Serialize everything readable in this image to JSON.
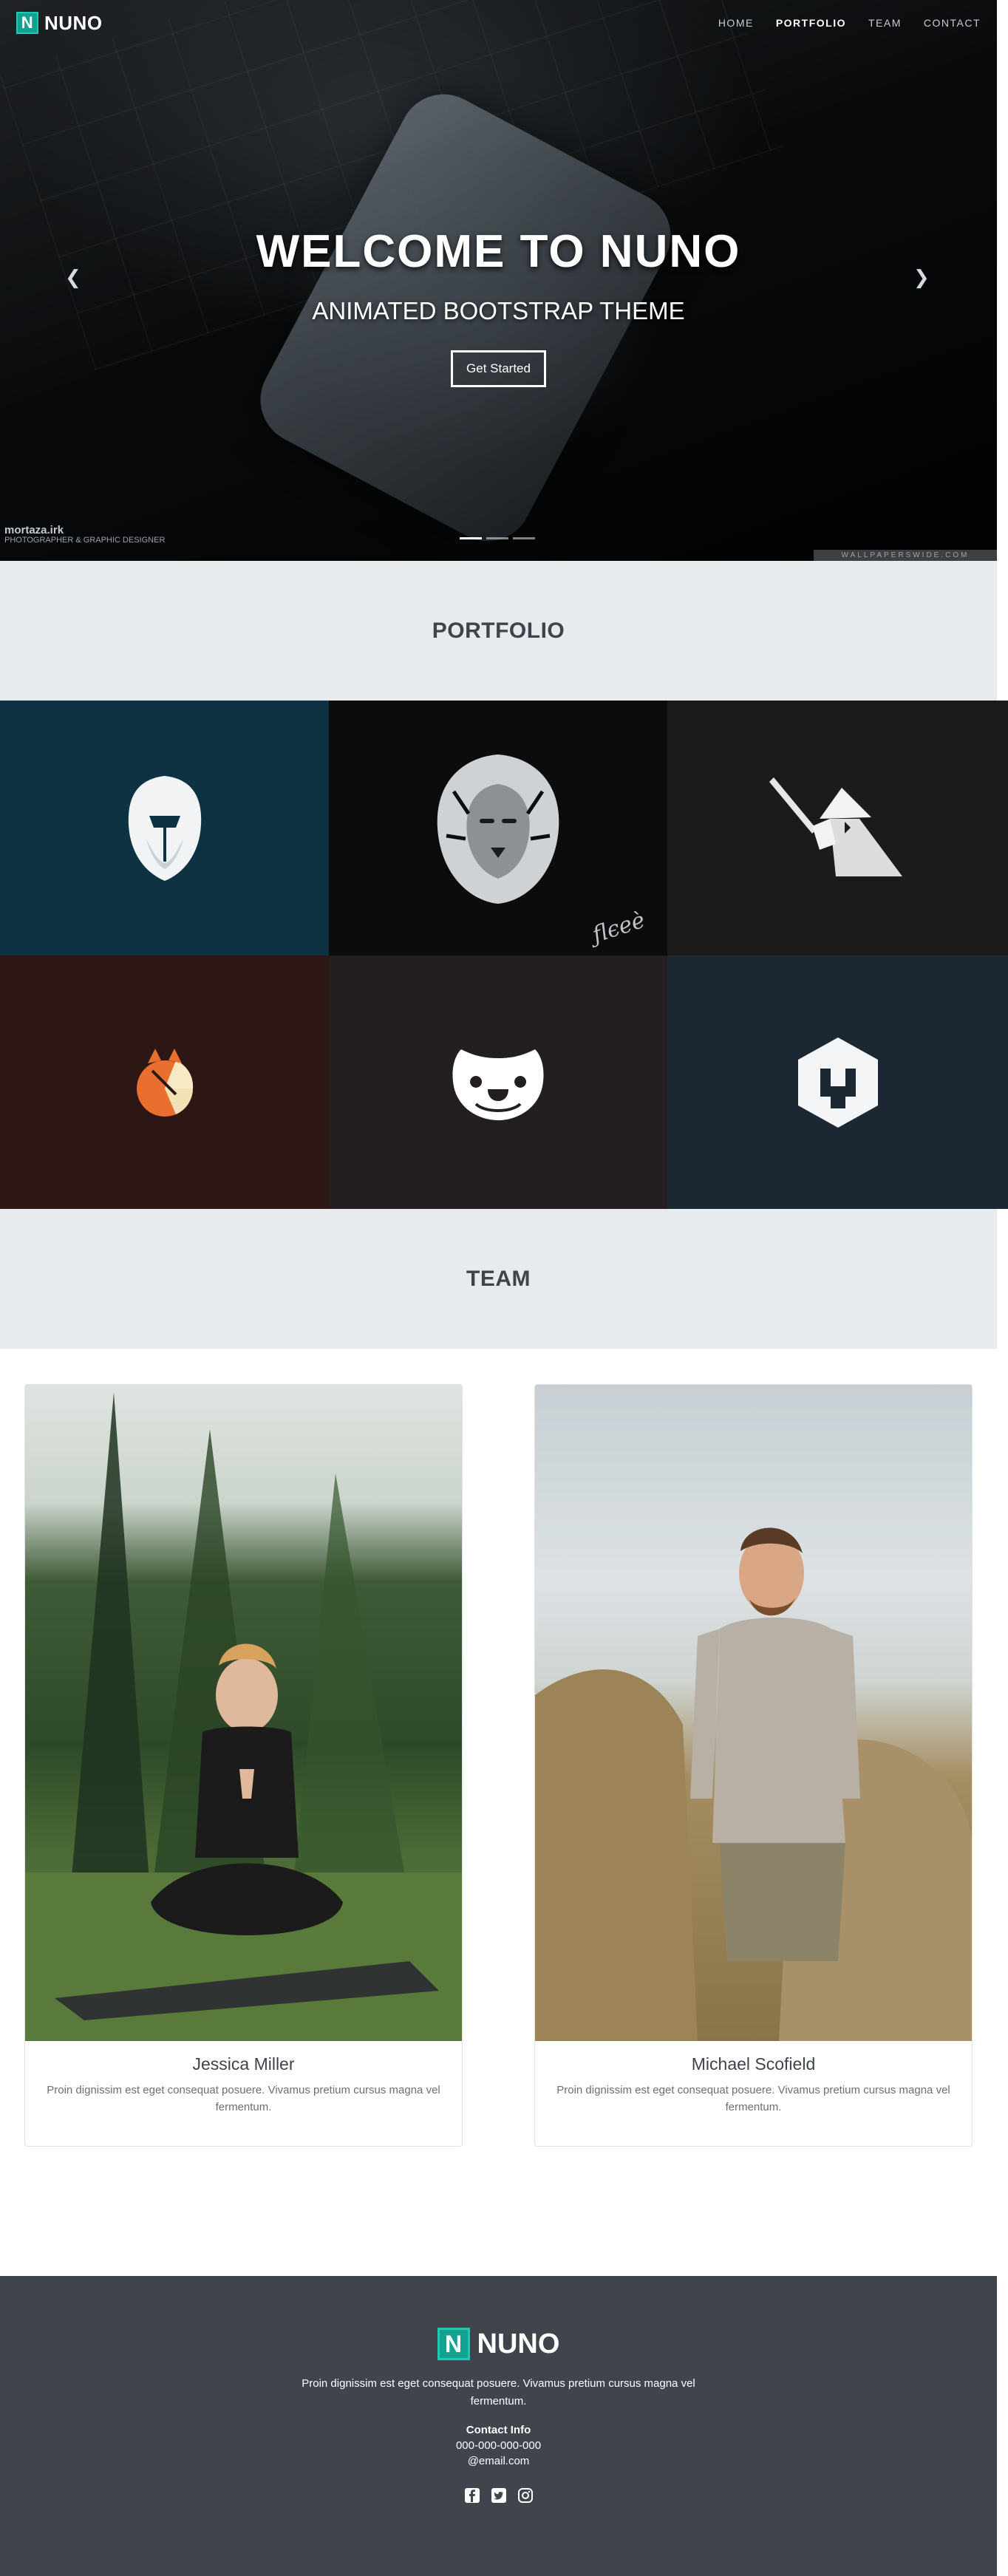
{
  "brand": {
    "name": "NUNO",
    "icon_letter": "N",
    "accent": "#1fc8b3"
  },
  "nav": {
    "items": [
      {
        "label": "HOME",
        "active": false
      },
      {
        "label": "PORTFOLIO",
        "active": true
      },
      {
        "label": "TEAM",
        "active": false
      },
      {
        "label": "CONTACT",
        "active": false
      }
    ]
  },
  "hero": {
    "title": "WELCOME TO NUNO",
    "subtitle": "ANIMATED BOOTSTRAP THEME",
    "button_label": "Get Started",
    "prev_icon": "chevron-left-icon",
    "next_icon": "chevron-right-icon",
    "slides_count": 3,
    "active_slide": 1,
    "watermark_left": "mortaza.irk",
    "watermark_left_sub": "PHOTOGRAPHER & GRAPHIC DESIGNER",
    "watermark_right": "WALLPAPERSWIDE.COM"
  },
  "portfolio": {
    "heading": "PORTFOLIO",
    "tiles": [
      {
        "icon": "spartan-helmet-icon",
        "bg": "#0d3342"
      },
      {
        "icon": "lion-head-icon",
        "bg": "#0c0c0d"
      },
      {
        "icon": "samurai-icon",
        "bg": "#1b1b1c"
      },
      {
        "icon": "fox-icon",
        "bg": "#2d1714"
      },
      {
        "icon": "bulldog-icon",
        "bg": "#231f20"
      },
      {
        "icon": "hexagon-wrench-icon",
        "bg": "#1b2732"
      }
    ]
  },
  "team": {
    "heading": "TEAM",
    "members": [
      {
        "name": "Jessica Miller",
        "text": "Proin dignissim est eget consequat posuere. Vivamus pretium cursus magna vel fermentum."
      },
      {
        "name": "Michael Scofield",
        "text": "Proin dignissim est eget consequat posuere. Vivamus pretium cursus magna vel fermentum."
      }
    ]
  },
  "footer": {
    "brand": "NUNO",
    "text": "Proin dignissim est eget consequat posuere. Vivamus pretium cursus magna vel fermentum.",
    "contact_label": "Contact Info",
    "phone": "000-000-000-000",
    "email": "@email.com",
    "socials": [
      "facebook-icon",
      "twitter-icon",
      "instagram-icon"
    ]
  }
}
